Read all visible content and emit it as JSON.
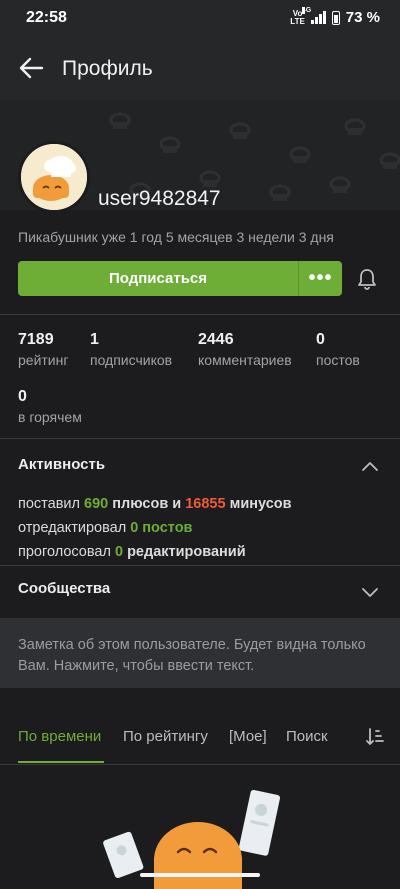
{
  "status_bar": {
    "time": "22:58",
    "volte_top": "Vo",
    "volte_bottom": "LTE",
    "network": "4G",
    "battery": "73 %"
  },
  "header": {
    "title": "Профиль",
    "back_icon": "arrow-left-icon"
  },
  "profile": {
    "username": "user9482847",
    "since": "Пикабушник уже 1 год 5 месяцев 3 недели 3 дня",
    "subscribe_label": "Подписаться",
    "more_label": "•••",
    "bell_icon": "bell-icon"
  },
  "stats": [
    {
      "value": "7189",
      "label": "рейтинг"
    },
    {
      "value": "1",
      "label": "подписчиков"
    },
    {
      "value": "2446",
      "label": "комментариев"
    },
    {
      "value": "0",
      "label": "постов"
    },
    {
      "value": "0",
      "label": "в горячем"
    }
  ],
  "activity": {
    "title": "Активность",
    "line1": {
      "prefix": "поставил",
      "plus_count": "690",
      "plus_word": "плюсов и",
      "minus_count": "16855",
      "minus_word": "минусов"
    },
    "line2": {
      "prefix": "отредактировал",
      "value": "0 постов"
    },
    "line3": {
      "prefix": "проголосовал",
      "value": "0",
      "suffix": "редактирований"
    }
  },
  "communities": {
    "title": "Сообщества"
  },
  "note": {
    "text": "Заметка об этом пользователе. Будет видна только Вам. Нажмите, чтобы ввести текст."
  },
  "tabs": [
    {
      "label": "По времени",
      "active": true
    },
    {
      "label": "По рейтингу",
      "active": false
    },
    {
      "label": "[Мое]",
      "active": false
    },
    {
      "label": "Поиск",
      "active": false
    }
  ],
  "colors": {
    "accent_green": "#6ead36",
    "minus_red": "#f05a3c",
    "background": "#1c1c1e"
  }
}
